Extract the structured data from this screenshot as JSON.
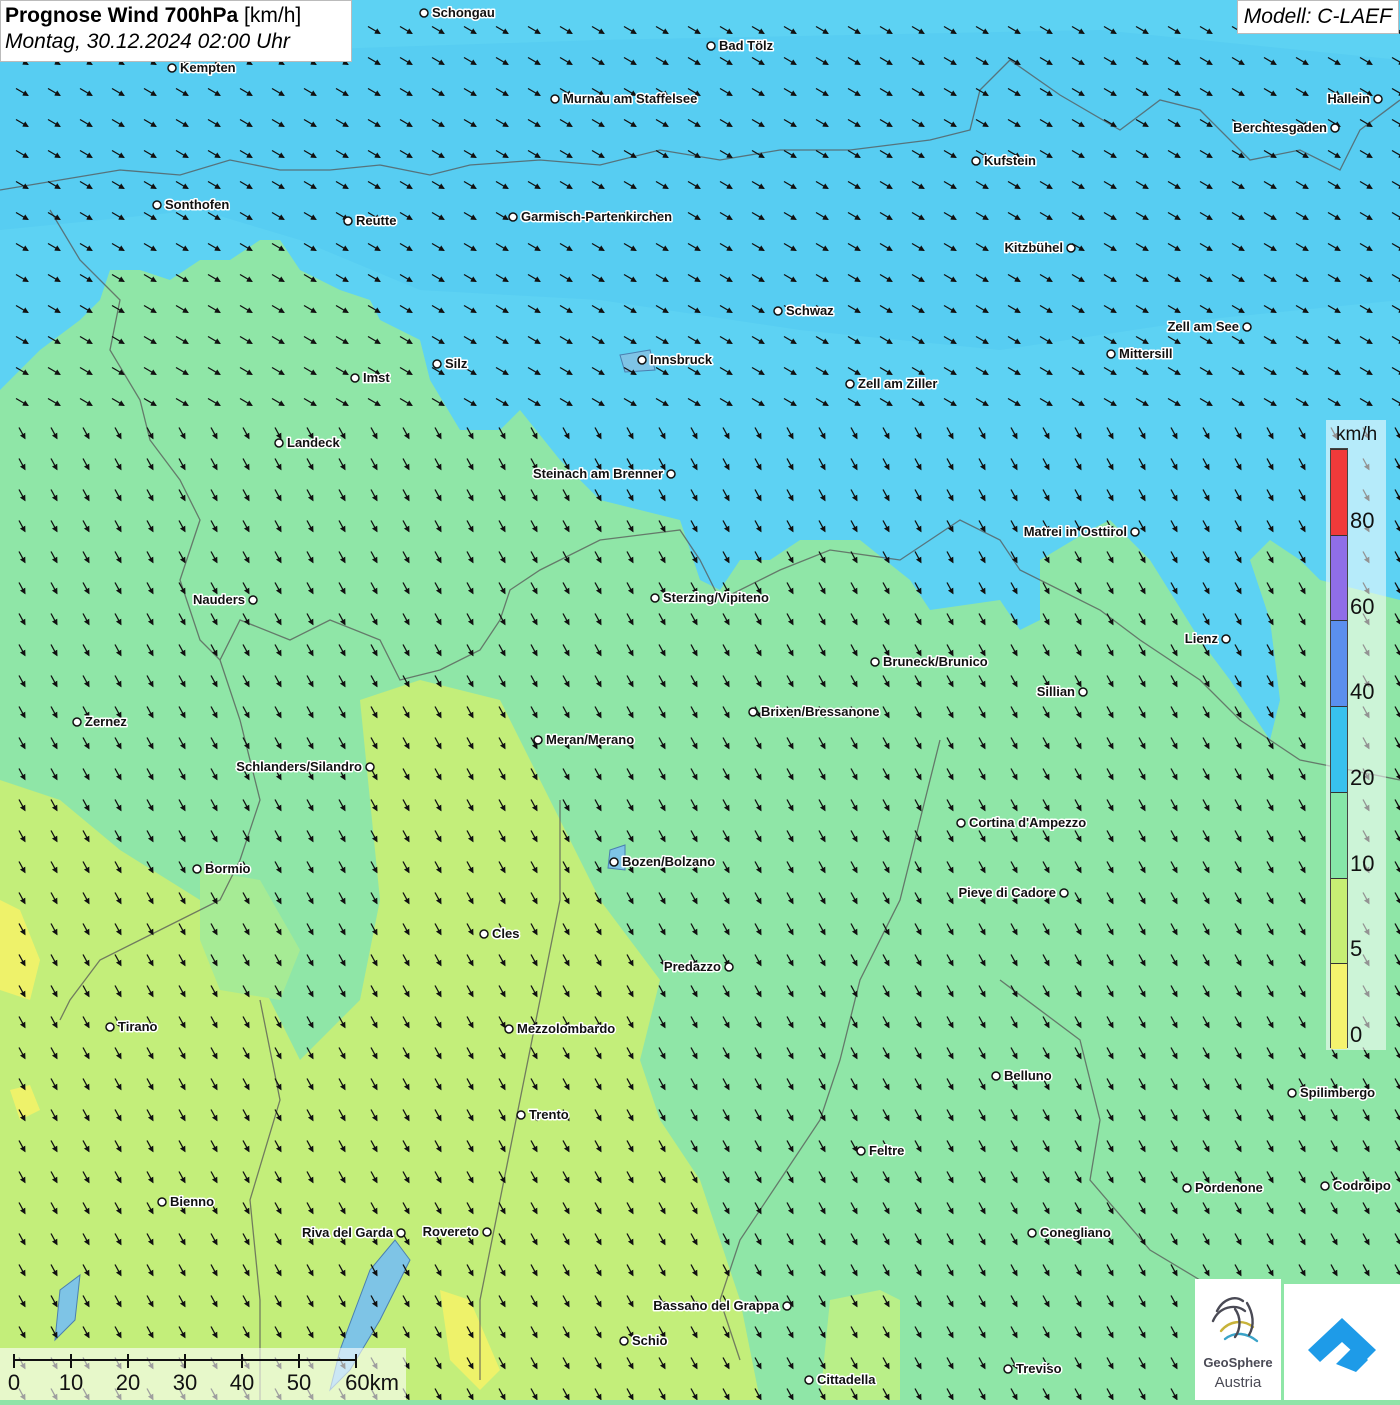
{
  "header": {
    "title_bold": "Prognose Wind 700hPa",
    "title_unit": " [km/h]",
    "datetime": "Montag, 30.12.2024 02:00 Uhr",
    "model": "Modell: C-LAEF"
  },
  "legend": {
    "unit": "km/h",
    "labels": [
      "80",
      "60",
      "40",
      "20",
      "10",
      "5",
      "0"
    ],
    "colors": [
      "#f03a3a",
      "#8f6ee8",
      "#5b8fee",
      "#38c1ee",
      "#86e6a8",
      "#c7ef74",
      "#f5f36e"
    ]
  },
  "cities": [
    {
      "name": "Schongau",
      "side": "right"
    },
    {
      "name": "Bad Tölz",
      "side": "right"
    },
    {
      "name": "Kempten",
      "side": "right"
    },
    {
      "name": "Murnau am Staffelsee",
      "side": "right"
    },
    {
      "name": "Hallein",
      "side": "left"
    },
    {
      "name": "Berchtesgaden",
      "side": "left"
    },
    {
      "name": "Kufstein",
      "side": "right"
    },
    {
      "name": "Sonthofen",
      "side": "right"
    },
    {
      "name": "Reutte",
      "side": "right"
    },
    {
      "name": "Garmisch-Partenkirchen",
      "side": "right"
    },
    {
      "name": "Kitzbühel",
      "side": "left"
    },
    {
      "name": "Schwaz",
      "side": "right"
    },
    {
      "name": "Zell am See",
      "side": "left"
    },
    {
      "name": "Silz",
      "side": "right"
    },
    {
      "name": "Innsbruck",
      "side": "right"
    },
    {
      "name": "Mittersill",
      "side": "right"
    },
    {
      "name": "Imst",
      "side": "right"
    },
    {
      "name": "Zell am Ziller",
      "side": "right"
    },
    {
      "name": "Landeck",
      "side": "right"
    },
    {
      "name": "Steinach am Brenner",
      "side": "left"
    },
    {
      "name": "Matrei in Osttirol",
      "side": "left"
    },
    {
      "name": "Nauders",
      "side": "left"
    },
    {
      "name": "Sterzing/Vipiteno",
      "side": "right"
    },
    {
      "name": "Lienz",
      "side": "left"
    },
    {
      "name": "Bruneck/Brunico",
      "side": "right"
    },
    {
      "name": "Sillian",
      "side": "left"
    },
    {
      "name": "Brixen/Bressanone",
      "side": "right"
    },
    {
      "name": "Zernez",
      "side": "right"
    },
    {
      "name": "Meran/Merano",
      "side": "right"
    },
    {
      "name": "Schlanders/Silandro",
      "side": "left"
    },
    {
      "name": "Cortina d'Ampezzo",
      "side": "right"
    },
    {
      "name": "Bozen/Bolzano",
      "side": "right"
    },
    {
      "name": "Bormio",
      "side": "right"
    },
    {
      "name": "Pieve di Cadore",
      "side": "left"
    },
    {
      "name": "Cles",
      "side": "right"
    },
    {
      "name": "Predazzo",
      "side": "left"
    },
    {
      "name": "Tirano",
      "side": "right"
    },
    {
      "name": "Mezzolombardo",
      "side": "right"
    },
    {
      "name": "Belluno",
      "side": "right"
    },
    {
      "name": "Spilimbergo",
      "side": "right"
    },
    {
      "name": "Trento",
      "side": "right"
    },
    {
      "name": "Feltre",
      "side": "right"
    },
    {
      "name": "Pordenone",
      "side": "right"
    },
    {
      "name": "Codroipo",
      "side": "right"
    },
    {
      "name": "Bienno",
      "side": "right"
    },
    {
      "name": "Riva del Garda",
      "side": "left"
    },
    {
      "name": "Rovereto",
      "side": "left"
    },
    {
      "name": "Conegliano",
      "side": "right"
    },
    {
      "name": "Bassano del Grappa",
      "side": "left"
    },
    {
      "name": "Schio",
      "side": "right"
    },
    {
      "name": "Treviso",
      "side": "right"
    },
    {
      "name": "Cittadella",
      "side": "right"
    }
  ],
  "scalebar": {
    "labels": [
      "0",
      "10",
      "20",
      "30",
      "40",
      "50",
      "60km"
    ]
  },
  "logos": {
    "geosphere_line1": "GeoSphere",
    "geosphere_line2": "Austria"
  },
  "colors": {
    "zone_blue": "#5bd1f2",
    "zone_lightblue": "#62d7ee",
    "zone_green": "#8fe6a7",
    "zone_lightgreen": "#b5ee89",
    "zone_yellowgreen": "#c9ef6f",
    "arrow": "#111111"
  }
}
